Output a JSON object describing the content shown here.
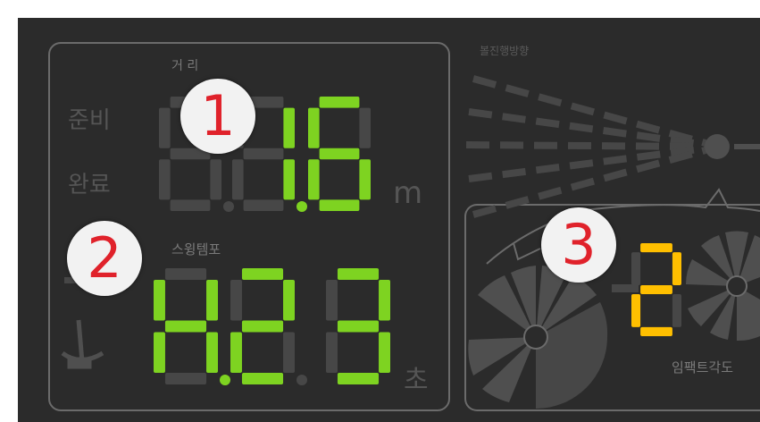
{
  "markers": {
    "one": "1",
    "two": "2",
    "three": "3"
  },
  "left_panel": {
    "ready_label": "준비",
    "done_label": "완료",
    "distance_label": "거 리",
    "distance_value": "1.6",
    "distance_unit": "m",
    "swing_tempo_label": "스윙템포",
    "swing_tempo_value": "H.23",
    "swing_tempo_unit": "초"
  },
  "right_panel": {
    "direction_label": "볼진행방향",
    "impact_angle_label": "임팩트각도",
    "impact_angle_value": "2"
  },
  "colors": {
    "background": "#2b2b2b",
    "segment_off": "#474747",
    "segment_green": "#7ed321",
    "segment_amber": "#ffbf00",
    "outline": "#6b6b6b",
    "label": "#7a7a7a",
    "marker_text": "#e0222b"
  }
}
